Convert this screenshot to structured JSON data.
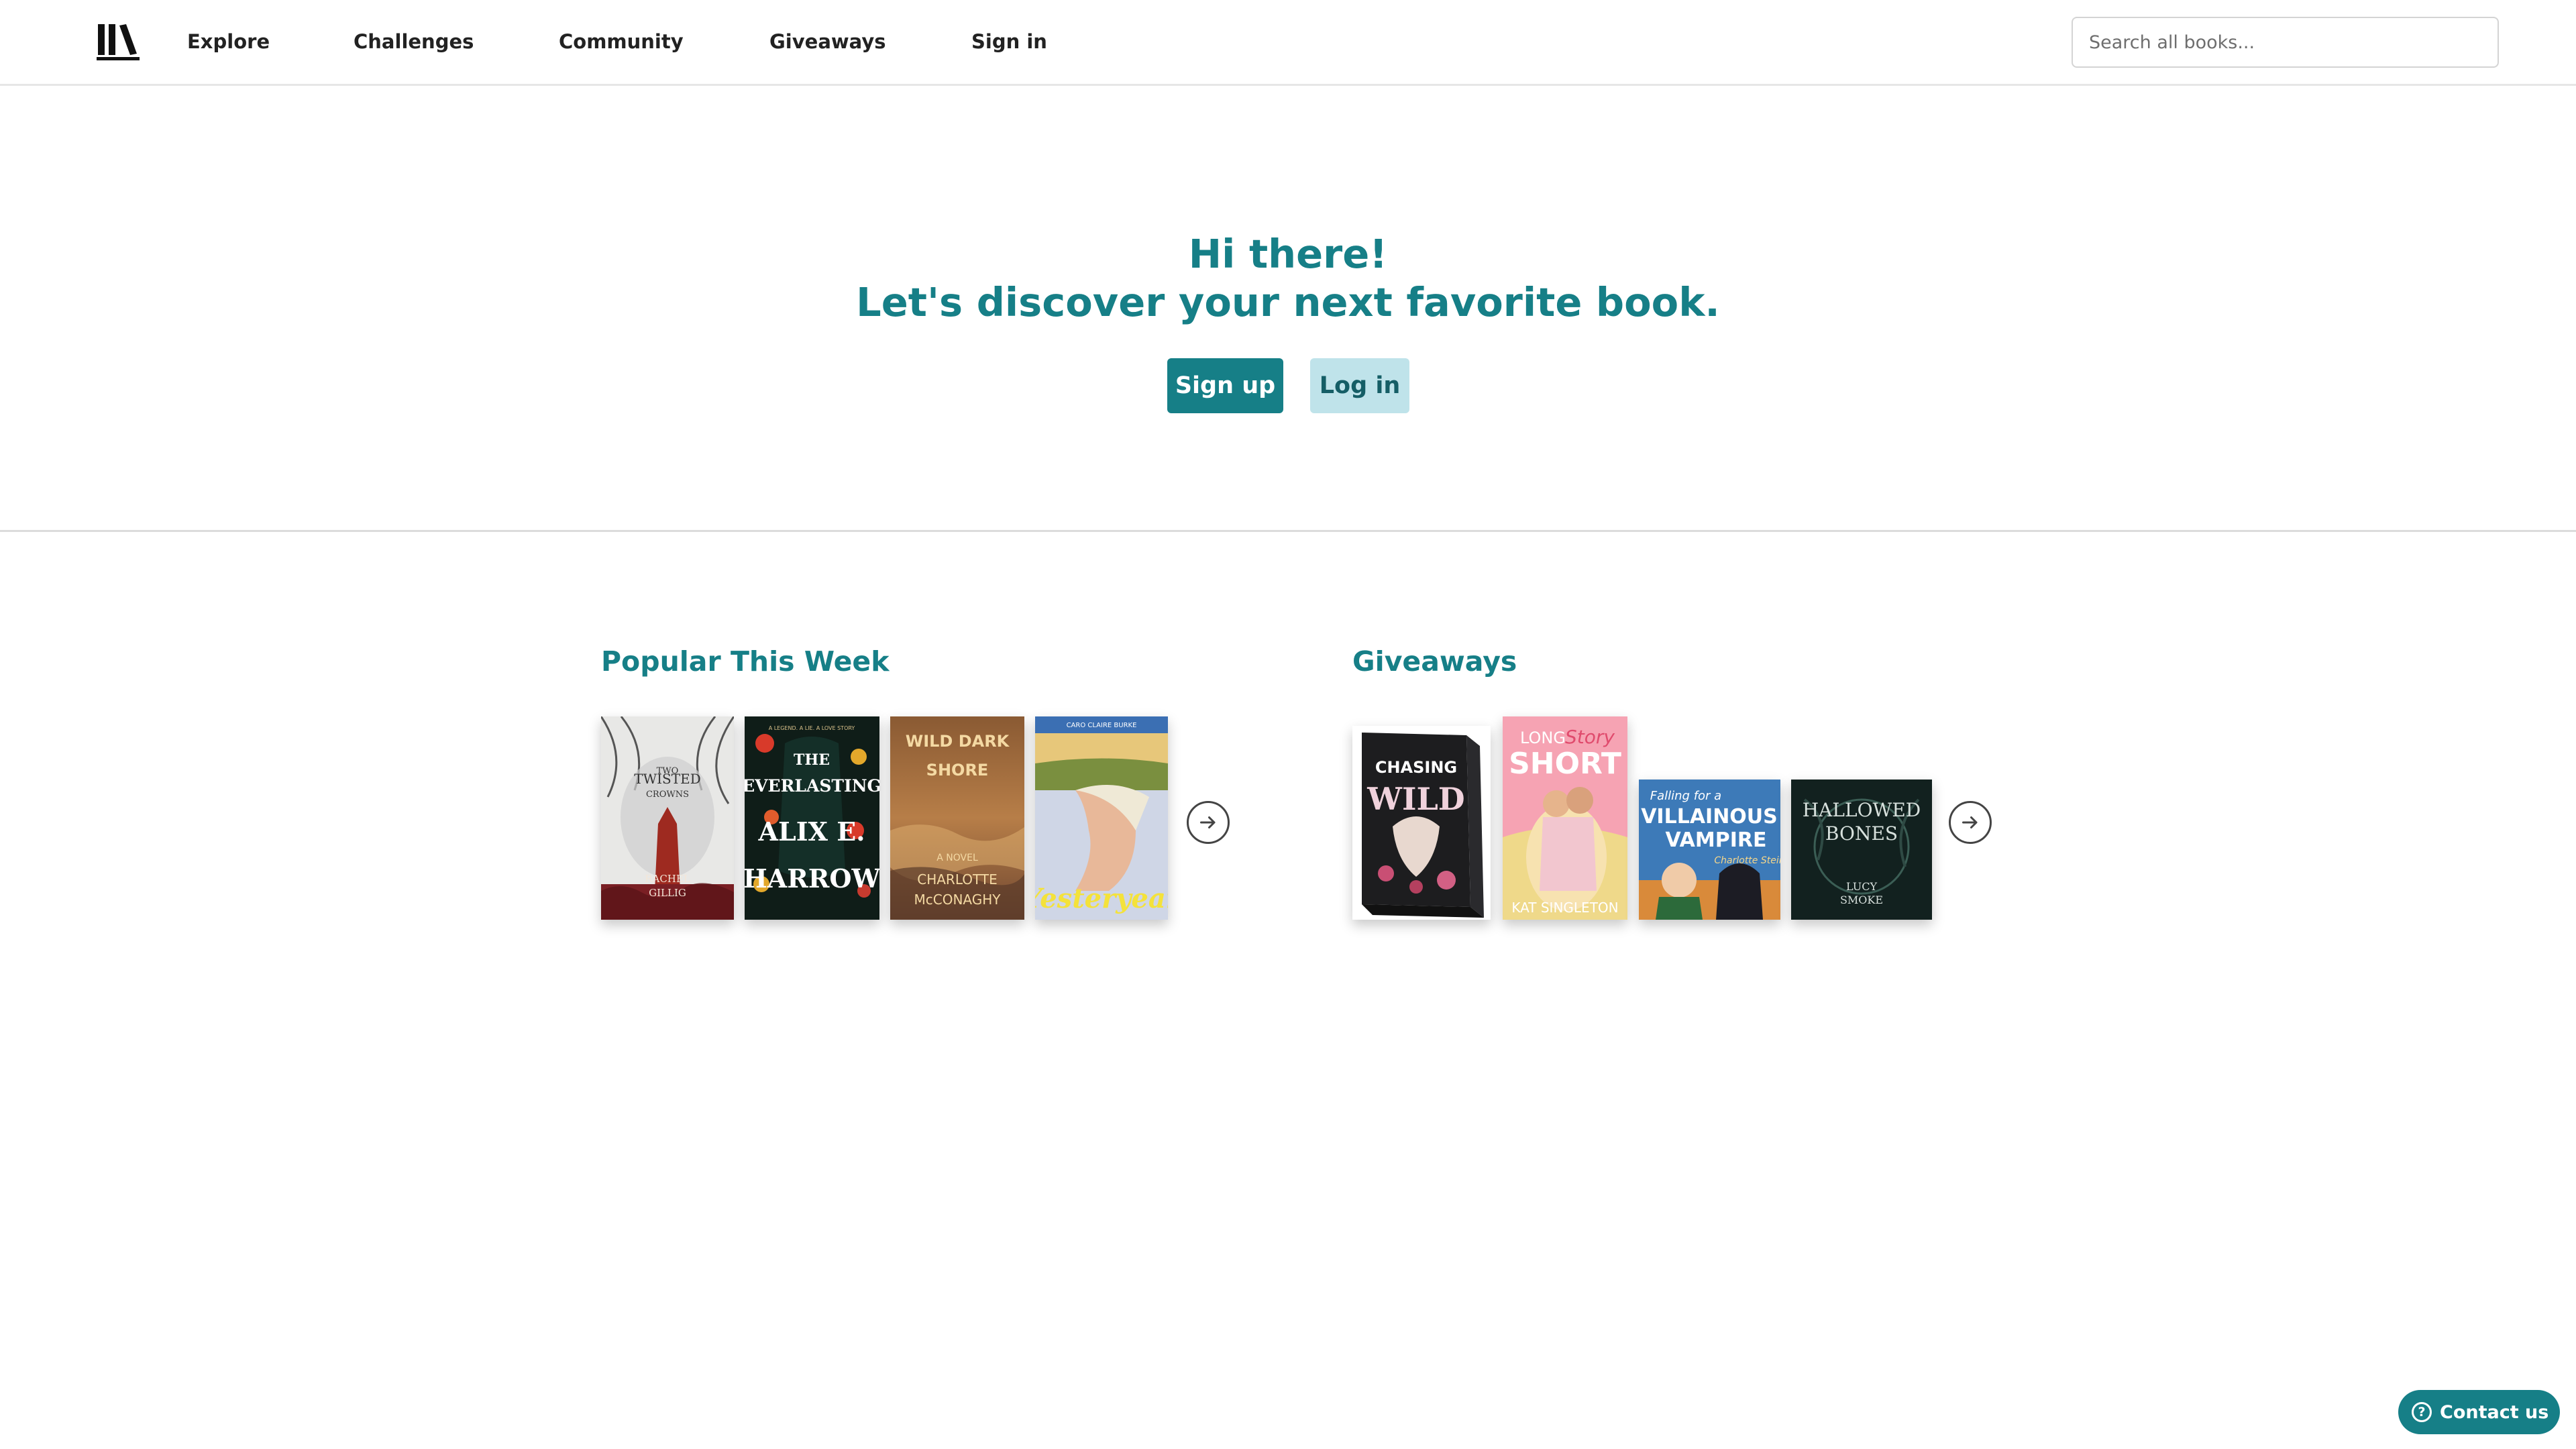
{
  "nav": {
    "links": [
      "Explore",
      "Challenges",
      "Community",
      "Giveaways",
      "Sign in"
    ],
    "search_placeholder": "Search all books..."
  },
  "hero": {
    "line1": "Hi there!",
    "line2": "Let's discover your next favorite book.",
    "signup": "Sign up",
    "login": "Log in"
  },
  "popular": {
    "title": "Popular This Week",
    "books": [
      {
        "title": "TWO TWISTED CROWNS",
        "author": "RACHEL GILLIG"
      },
      {
        "title": "THE EVERLASTING",
        "author": "ALIX E. HARROW",
        "tagline": "A LEGEND. A LIE. A LOVE STORY"
      },
      {
        "title": "WILD DARK SHORE",
        "author": "CHARLOTTE McCONAGHY",
        "tagline": "A NOVEL"
      },
      {
        "title": "Yesteryear",
        "author": "CARO CLAIRE BURKE"
      }
    ]
  },
  "giveaways": {
    "title": "Giveaways",
    "books": [
      {
        "title": "CHASING WILD"
      },
      {
        "title": "LONG Story SHORT",
        "author": "KAT SINGLETON"
      },
      {
        "title": "Falling for a VILLAINOUS VAMPIRE",
        "author": "Charlotte Stein"
      },
      {
        "title": "HALLOWED BONES",
        "author": "LUCY SMOKE"
      }
    ]
  },
  "contact": {
    "label": "Contact us"
  },
  "colors": {
    "accent": "#167f87",
    "accent_light": "#bfe3ea"
  }
}
